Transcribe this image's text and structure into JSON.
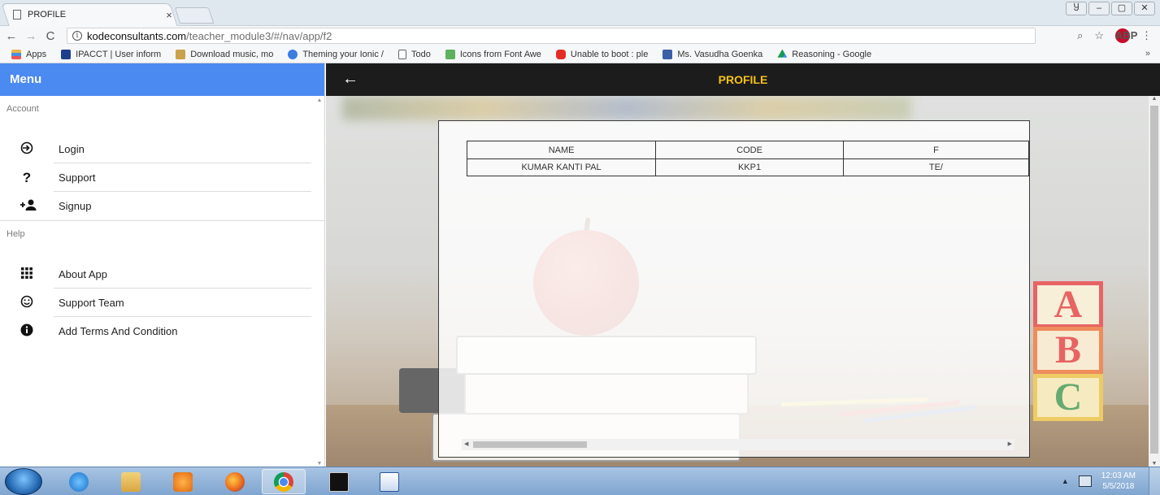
{
  "browser": {
    "tab_title": "PROFILE",
    "tab_close": "×",
    "window_controls": [
      "Ⴘ",
      "–",
      "▢",
      "✕"
    ],
    "nav": {
      "back": "←",
      "forward": "→",
      "reload": "C"
    },
    "url_host": "kodeconsultants.com",
    "url_path": "/teacher_module3/#/nav/app/f2",
    "info_icon": "i",
    "zoom_icon": "⌕",
    "star_icon": "☆",
    "abp_label": "ABP",
    "menu_icon": "⋮",
    "bookmarks": [
      {
        "label": "Apps",
        "color": "#e8b84a"
      },
      {
        "label": "IPACCT | User inform",
        "color": "#1f3f8a"
      },
      {
        "label": "Download music, mo",
        "color": "#c9a24a"
      },
      {
        "label": "Theming your Ionic /",
        "color": "#3b7de0"
      },
      {
        "label": "Todo",
        "color": "#ffffff"
      },
      {
        "label": "Icons from Font Awe",
        "color": "#5fb05f"
      },
      {
        "label": "Unable to boot : ple",
        "color": "#e52d27"
      },
      {
        "label": "Ms. Vasudha Goenka",
        "color": "#3b5ea8"
      },
      {
        "label": "Reasoning - Google",
        "color": "#f4b400"
      }
    ],
    "bookmarks_more": "»"
  },
  "menu": {
    "title": "Menu",
    "sections": [
      {
        "heading": "Account",
        "items": [
          {
            "label": "Login",
            "icon": "login-icon",
            "glyph": "⟳"
          },
          {
            "label": "Support",
            "icon": "help-icon",
            "glyph": "?"
          },
          {
            "label": "Signup",
            "icon": "person-add-icon",
            "glyph": "+👤"
          }
        ]
      },
      {
        "heading": "Help",
        "items": [
          {
            "label": "About App",
            "icon": "apps-grid-icon",
            "glyph": "⠿"
          },
          {
            "label": "Support Team",
            "icon": "smiley-icon",
            "glyph": "☺"
          },
          {
            "label": "Add Terms And Condition",
            "icon": "info-icon",
            "glyph": "ℹ"
          }
        ]
      }
    ]
  },
  "toolbar": {
    "back": "←",
    "title": "PROFILE",
    "title_color": "#f5c11a"
  },
  "profile_table": {
    "headers": [
      "NAME",
      "CODE",
      "F"
    ],
    "rows": [
      [
        "KUMAR KANTI PAL",
        "KKP1",
        "TE/"
      ]
    ]
  },
  "blocks": {
    "a": "A",
    "b": "B",
    "c": "C"
  },
  "taskbar": {
    "clock_time": "12:03 AM",
    "clock_date": "5/5/2018",
    "tray_up": "▲"
  },
  "colors": {
    "menu_header": "#4b8af0",
    "toolbar": "#1c1c1c"
  }
}
